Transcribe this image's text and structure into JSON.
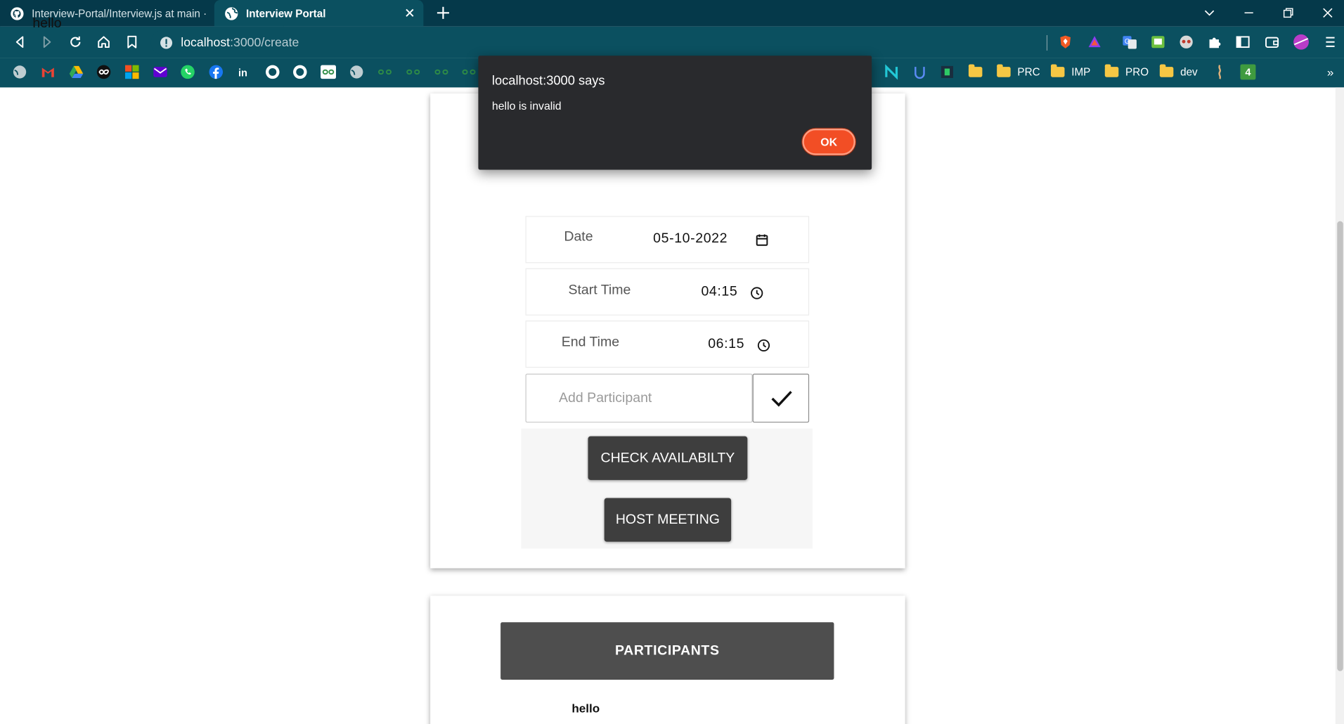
{
  "browser": {
    "tabs": [
      {
        "title": "Interview-Portal/Interview.js at main · s",
        "active": false,
        "icon": "github-icon"
      },
      {
        "title": "Interview Portal",
        "active": true,
        "icon": "globe-icon"
      }
    ],
    "url_host": "localhost",
    "url_path": ":3000/create",
    "bookmark_folders": [
      "PRC",
      "IMP",
      "PRO",
      "dev"
    ],
    "bookmark_badge": "4"
  },
  "dialog": {
    "title": "localhost:3000 says",
    "message": "hello is invalid",
    "ok_label": "OK"
  },
  "form": {
    "title_value": "hello",
    "date_label": "Date",
    "date_value": "05-10-2022",
    "start_label": "Start Time",
    "start_value": "04:15",
    "end_label": "End Time",
    "end_value": "06:15",
    "participant_placeholder": "Add Participant",
    "check_label": "CHECK AVAILABILTY",
    "host_label": "HOST MEETING"
  },
  "participants": {
    "header": "PARTICIPANTS",
    "items": [
      "hello"
    ]
  },
  "colors": {
    "chrome_dark": "#05394a",
    "chrome": "#0b5060",
    "button_dark": "#3e3e3e",
    "ok_button": "#f24e25"
  }
}
